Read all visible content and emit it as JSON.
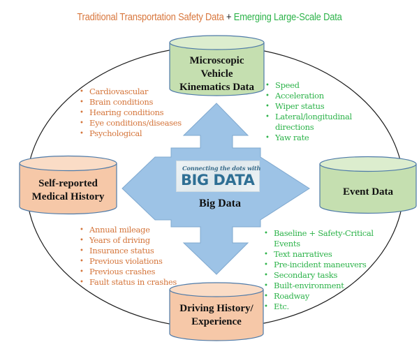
{
  "title": {
    "traditional": "Traditional Transportation Safety Data",
    "plus": "+",
    "emerging": "Emerging Large-Scale Data"
  },
  "colors": {
    "traditional_orange": "#D4753B",
    "emerging_green": "#2DB34A",
    "cylinder_green": "#C5DFB0",
    "cylinder_orange": "#F6C8A8",
    "arrow_blue": "#9DC3E6"
  },
  "center": {
    "badge_small": "Connecting the dots with",
    "badge_big": "BIG DATA",
    "label": "Big Data"
  },
  "cylinders": {
    "top": {
      "label": "Microscopic Vehicle Kinematics Data",
      "lines": [
        "Microscopic",
        "Vehicle",
        "Kinematics Data"
      ],
      "type": "emerging"
    },
    "left": {
      "label": "Self-reported Medical History",
      "lines": [
        "Self-reported",
        "Medical History"
      ],
      "type": "traditional"
    },
    "right": {
      "label": "Event Data",
      "lines": [
        "Event Data"
      ],
      "type": "emerging"
    },
    "bottom": {
      "label": "Driving History/ Experience",
      "lines": [
        "Driving History/",
        "Experience"
      ],
      "type": "traditional"
    }
  },
  "lists": {
    "medical": [
      "Cardiovascular",
      "Brain conditions",
      "Hearing conditions",
      "Eye conditions/diseases",
      "Psychological"
    ],
    "kinematics": [
      "Speed",
      "Acceleration",
      "Wiper status",
      "Lateral/longitudinal",
      "directions",
      "Yaw rate"
    ],
    "driving": [
      "Annual mileage",
      "Years of driving",
      "Insurance status",
      "Previous violations",
      "Previous crashes",
      "Fault status in crashes"
    ],
    "event": [
      "Baseline + Safety-Critical",
      "Events",
      "Text narratives",
      "Pre-incident maneuvers",
      "Secondary tasks",
      "Built-environment",
      "Roadway",
      "Etc."
    ]
  }
}
